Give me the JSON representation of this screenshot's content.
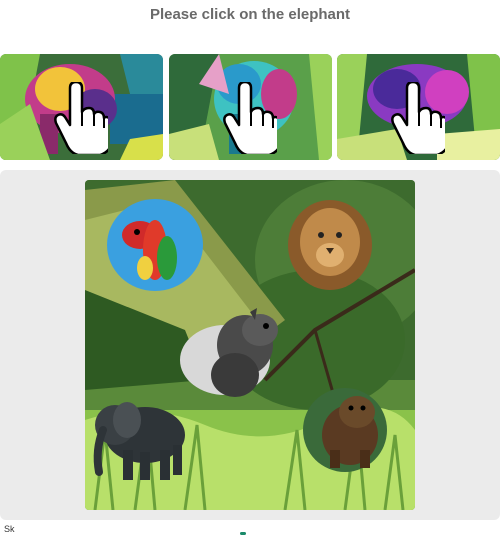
{
  "prompt": {
    "text": "Please click on the elephant"
  },
  "thumbnails": [
    {
      "name": "elephant-thumbnail-1",
      "icon": "pointer-hand-icon"
    },
    {
      "name": "elephant-thumbnail-2",
      "icon": "pointer-hand-icon"
    },
    {
      "name": "elephant-thumbnail-3",
      "icon": "pointer-hand-icon"
    }
  ],
  "scene": {
    "animals": [
      "parrot",
      "lion",
      "squirrel",
      "elephant",
      "bear"
    ]
  },
  "footer": {
    "left_text": "Sk"
  }
}
